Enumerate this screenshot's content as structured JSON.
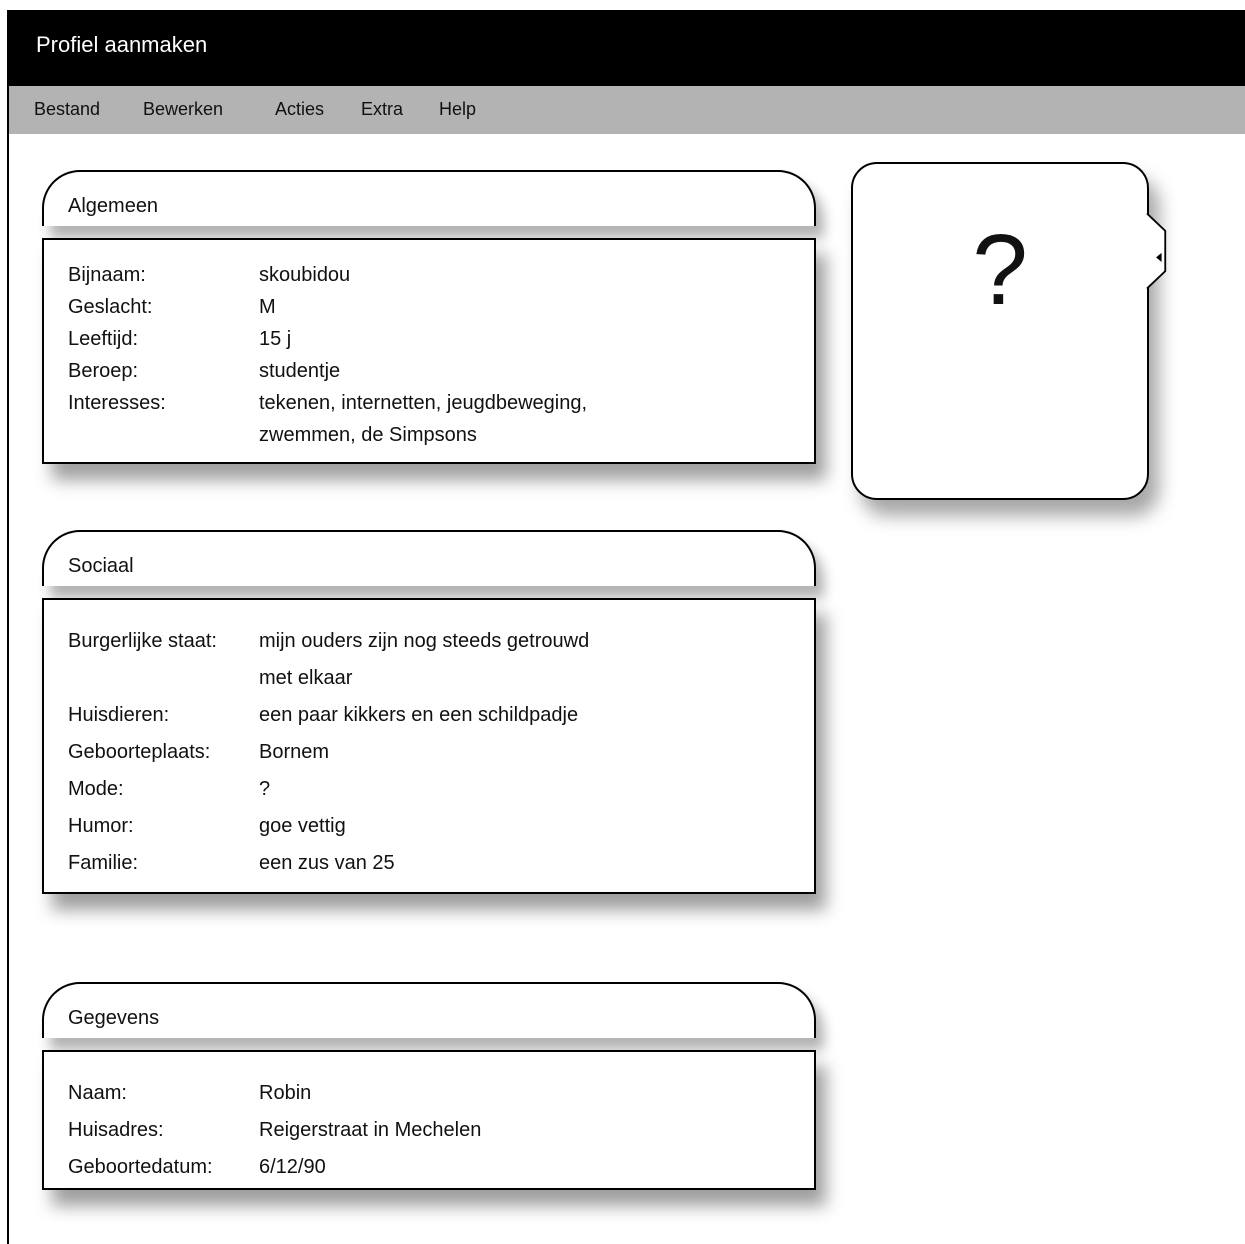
{
  "window": {
    "title": "Profiel aanmaken"
  },
  "menu": [
    "Bestand",
    "Bewerken",
    "Acties",
    "Extra",
    "Help"
  ],
  "photo": {
    "placeholder": "?"
  },
  "sections": {
    "algemeen": {
      "title": "Algemeen",
      "rows": [
        {
          "label": "Bijnaam:",
          "value": "skoubidou"
        },
        {
          "label": "Geslacht:",
          "value": "M"
        },
        {
          "label": "Leeftijd:",
          "value": "15 j"
        },
        {
          "label": "Beroep:",
          "value": "studentje"
        },
        {
          "label": "Interesses:",
          "value": "tekenen, internetten, jeugdbeweging,"
        },
        {
          "label": "",
          "value": "zwemmen, de Simpsons"
        }
      ]
    },
    "sociaal": {
      "title": "Sociaal",
      "rows": [
        {
          "label": "Burgerlijke staat:",
          "value": "mijn ouders zijn nog steeds getrouwd"
        },
        {
          "label": "",
          "value": "met elkaar"
        },
        {
          "label": "Huisdieren:",
          "value": "een paar kikkers en een schildpadje"
        },
        {
          "label": "Geboorteplaats:",
          "value": "Bornem"
        },
        {
          "label": "Mode:",
          "value": "?"
        },
        {
          "label": "Humor:",
          "value": "goe vettig"
        },
        {
          "label": "Familie:",
          "value": "een zus van 25"
        }
      ]
    },
    "gegevens": {
      "title": "Gegevens",
      "rows": [
        {
          "label": "Naam:",
          "value": "Robin"
        },
        {
          "label": "Huisadres:",
          "value": "Reigerstraat in Mechelen"
        },
        {
          "label": "Geboortedatum:",
          "value": "6/12/90"
        }
      ]
    }
  }
}
